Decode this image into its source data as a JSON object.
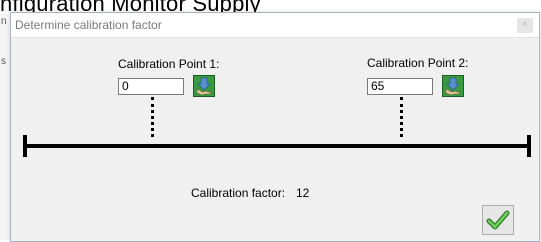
{
  "background": {
    "heading_text": "nfiguration Monitor Supply",
    "left_glyphs": [
      "n",
      "s"
    ]
  },
  "dialog": {
    "title": "Determine calibration factor",
    "close_label": "×",
    "point1": {
      "label": "Calibration Point 1:",
      "value": "0",
      "button_icon": "arrow-down-pick-icon"
    },
    "point2": {
      "label": "Calibration Point 2:",
      "value": "65",
      "button_icon": "arrow-down-pick-icon"
    },
    "factor": {
      "label": "Calibration factor:",
      "value": "12"
    },
    "ok_icon": "green-checkmark-icon"
  },
  "colors": {
    "dialog_bg": "#f0f0f0",
    "pick_button_green": "#2f8f35",
    "check_green": "#3da535"
  }
}
